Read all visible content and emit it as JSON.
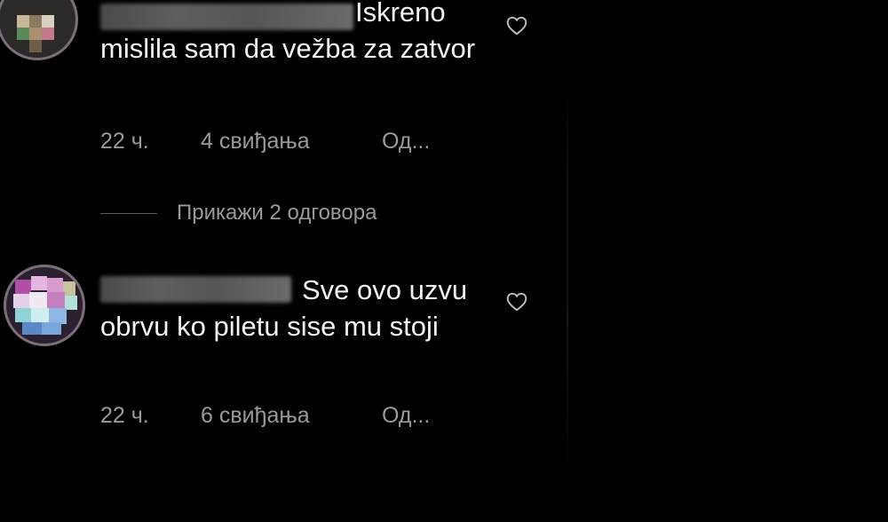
{
  "comments": [
    {
      "username": "",
      "text": "Iskreno mislila sam da vežba za zatvor",
      "time": "22 ч.",
      "likes": "4 свиђања",
      "reply": "Од...",
      "liked": false
    },
    {
      "username": "",
      "text": "Sve ovo uzvu obrvu ko piletu sise mu stoji",
      "time": "22 ч.",
      "likes": "6 свиђања",
      "reply": "Од...",
      "liked": false
    }
  ],
  "view_replies": "Прикажи 2 одговора",
  "icons": {
    "like": "heart-outline-icon"
  },
  "colors": {
    "background": "#000000",
    "text": "#f2f2f2",
    "meta": "#9a9a9a"
  }
}
